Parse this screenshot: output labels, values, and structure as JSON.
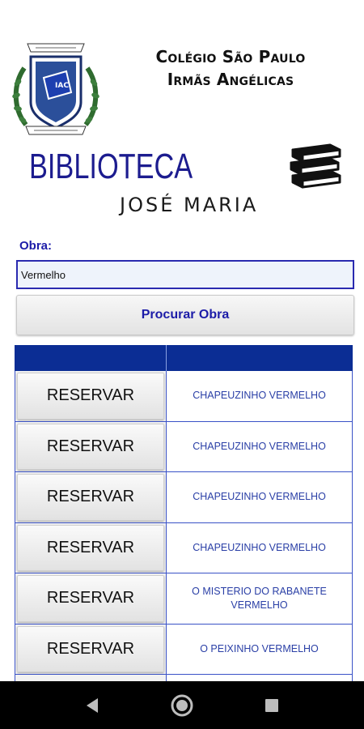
{
  "header": {
    "school_line1": "Colégio São Paulo",
    "school_line2": "Irmãs Angélicas",
    "crest_icon": "school-crest-icon",
    "library_title": "BIBLIOTECA",
    "library_subtitle": "JOSÉ MARIA",
    "books_icon": "stacked-books-icon"
  },
  "search": {
    "label": "Obra:",
    "value": "Vermelho",
    "button_label": "Procurar Obra"
  },
  "results": {
    "header_color": "#0b2d94",
    "rows": [
      {
        "action": "RESERVAR",
        "title": "CHAPEUZINHO VERMELHO"
      },
      {
        "action": "RESERVAR",
        "title": "CHAPEUZINHO VERMELHO"
      },
      {
        "action": "RESERVAR",
        "title": "CHAPEUZINHO VERMELHO"
      },
      {
        "action": "RESERVAR",
        "title": "CHAPEUZINHO VERMELHO"
      },
      {
        "action": "RESERVAR",
        "title": "O MISTERIO DO RABANETE VERMELHO"
      },
      {
        "action": "RESERVAR",
        "title": "O PEIXINHO VERMELHO"
      }
    ]
  },
  "navbar": {
    "back_icon": "back-triangle-icon",
    "home_icon": "home-circle-icon",
    "recents_icon": "recents-square-icon"
  },
  "colors": {
    "accent": "#1c1ca8",
    "title_blue": "#1c1c8f",
    "table_border": "#3a52c7"
  }
}
